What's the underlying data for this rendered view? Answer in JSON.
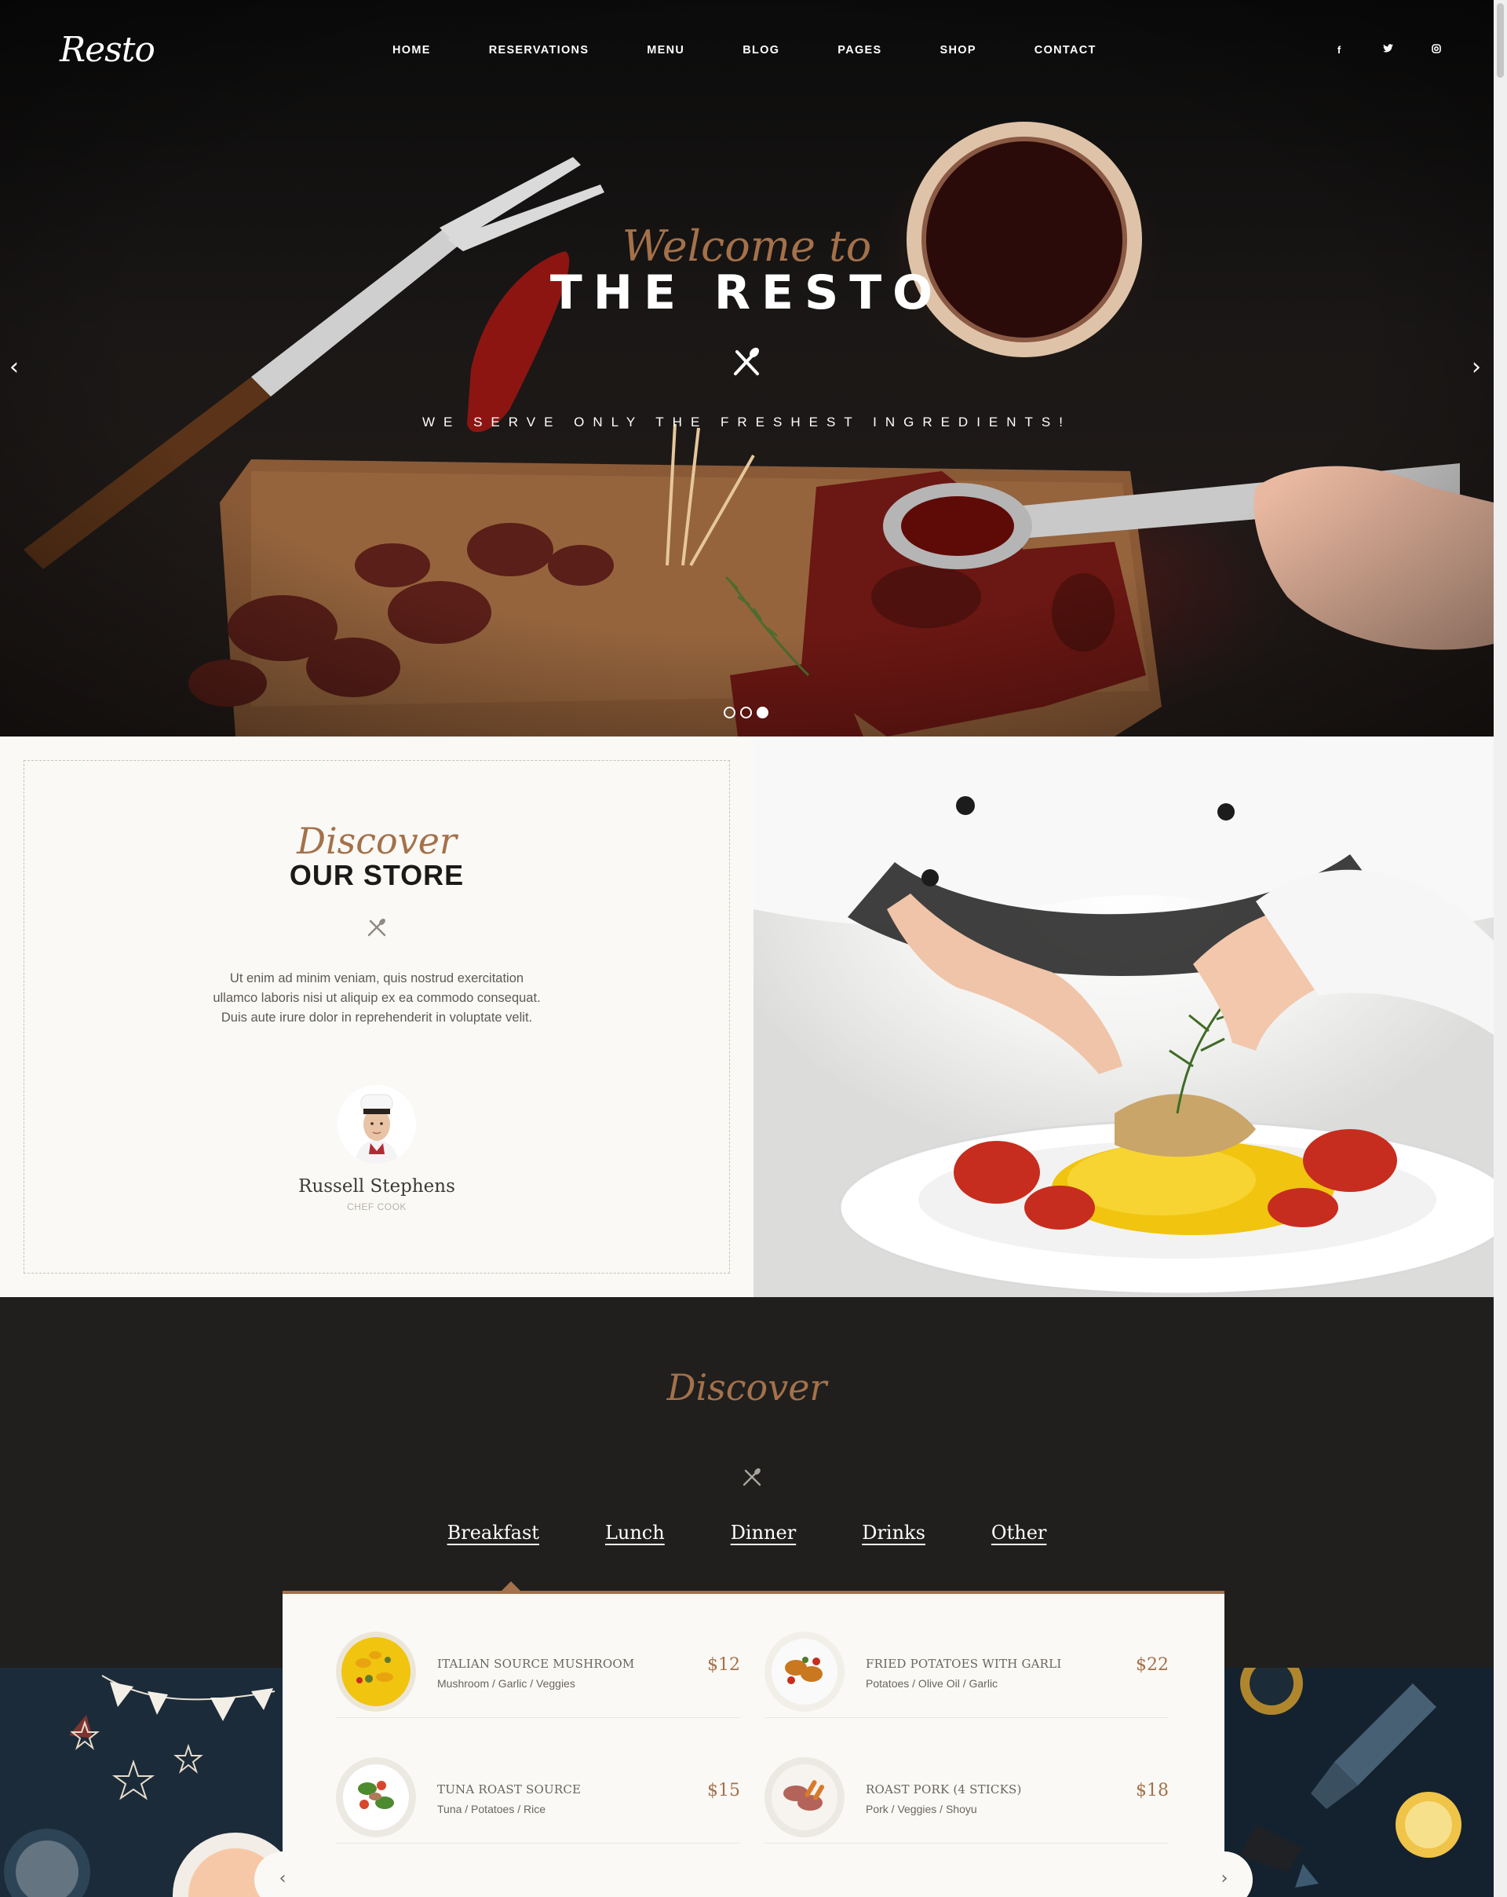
{
  "brand": {
    "logo": "Resto"
  },
  "nav": [
    "HOME",
    "RESERVATIONS",
    "MENU",
    "BLOG",
    "PAGES",
    "SHOP",
    "CONTACT"
  ],
  "social": [
    {
      "icon": "facebook-icon",
      "glyph": "f"
    },
    {
      "icon": "twitter-icon",
      "glyph": "t"
    },
    {
      "icon": "instagram-icon",
      "glyph": "◎"
    }
  ],
  "hero": {
    "script": "Welcome to",
    "title": "THE RESTO",
    "tagline": "WE SERVE ONLY THE FRESHEST INGREDIENTS!",
    "prev": "‹",
    "next": "›",
    "slides": 3,
    "active_slide": 3
  },
  "about": {
    "script": "Discover",
    "title": "OUR STORE",
    "text": "Ut enim ad minim veniam, quis nostrud exercitation ullamco laboris nisi ut aliquip ex ea commodo consequat. Duis aute irure dolor in reprehenderit in voluptate velit.",
    "chef_name": "Russell Stephens",
    "chef_role": "CHEF COOK"
  },
  "menu": {
    "script": "Discover",
    "tabs": [
      "Breakfast",
      "Lunch",
      "Dinner",
      "Drinks",
      "Other"
    ],
    "active_tab": "Breakfast",
    "items": [
      {
        "name": "ITALIAN SOURCE MUSHROOM",
        "ingredients": "Mushroom / Garlic / Veggies",
        "price": "$12"
      },
      {
        "name": "FRIED POTATOES WITH GARLI",
        "ingredients": "Potatoes / Olive Oil / Garlic",
        "price": "$22"
      },
      {
        "name": "TUNA ROAST SOURCE",
        "ingredients": "Tuna / Potatoes / Rice",
        "price": "$15"
      },
      {
        "name": "ROAST PORK (4 STICKS)",
        "ingredients": "Pork / Veggies / Shoyu",
        "price": "$18"
      }
    ],
    "prev": "‹",
    "next": "›"
  },
  "colors": {
    "accent": "#a4714a",
    "dark": "#201f1e",
    "light": "#faf9f6"
  }
}
